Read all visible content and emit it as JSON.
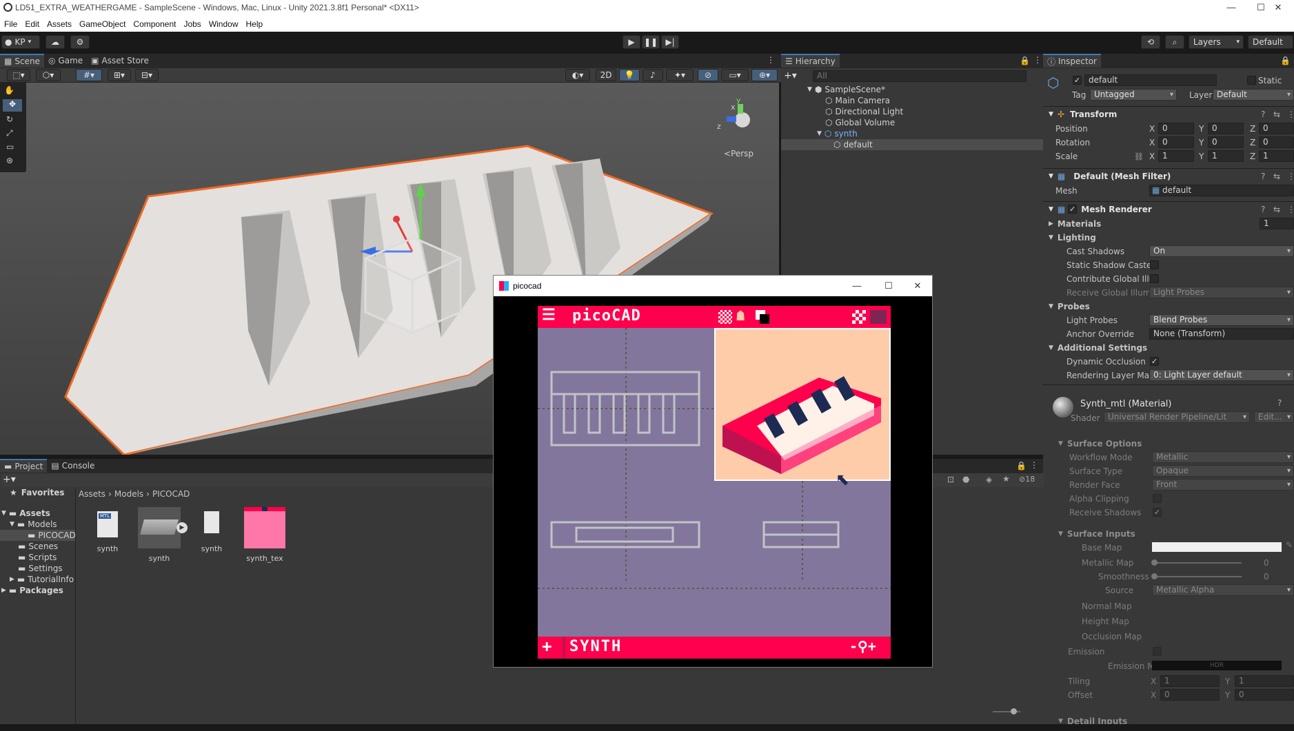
{
  "window": {
    "title": "LD51_EXTRA_WEATHERGAME - SampleScene - Windows, Mac, Linux - Unity 2021.3.8f1 Personal* <DX11>",
    "minimize": "—",
    "maximize": "☐",
    "close": "✕"
  },
  "menu": [
    "File",
    "Edit",
    "Assets",
    "GameObject",
    "Component",
    "Jobs",
    "Window",
    "Help"
  ],
  "toolbar": {
    "account": "KP",
    "layers": "Layers",
    "layout": "Default"
  },
  "scene_tabs": [
    "Scene",
    "Game",
    "Asset Store"
  ],
  "scene": {
    "mode_2d": "2D",
    "persp_label": "<Persp",
    "axis_x": "x",
    "axis_y": "y",
    "axis_z": "z"
  },
  "hierarchy": {
    "tab": "Hierarchy",
    "search_placeholder": "All",
    "items": [
      {
        "label": "SampleScene*"
      },
      {
        "label": "Main Camera"
      },
      {
        "label": "Directional Light"
      },
      {
        "label": "Global Volume"
      },
      {
        "label": "synth"
      },
      {
        "label": "default"
      }
    ]
  },
  "inspector": {
    "tab": "Inspector",
    "object_name": "default",
    "static_label": "Static",
    "tag_label": "Tag",
    "tag_value": "Untagged",
    "layer_label": "Layer",
    "layer_value": "Default",
    "transform": {
      "title": "Transform",
      "position_label": "Position",
      "rotation_label": "Rotation",
      "scale_label": "Scale",
      "position": [
        "0",
        "0",
        "0"
      ],
      "rotation": [
        "0",
        "0",
        "0"
      ],
      "scale": [
        "1",
        "1",
        "1"
      ],
      "x": "X",
      "y": "Y",
      "z": "Z"
    },
    "mesh_filter": {
      "title": "Default (Mesh Filter)",
      "mesh_label": "Mesh",
      "mesh_value": "default"
    },
    "mesh_renderer": {
      "title": "Mesh Renderer",
      "materials_label": "Materials",
      "materials_count": "1",
      "lighting_label": "Lighting",
      "cast_shadows_label": "Cast Shadows",
      "cast_shadows_value": "On",
      "static_shadow_label": "Static Shadow Caste",
      "contribute_gi_label": "Contribute Global Illu",
      "receive_gi_label": "Receive Global Illumi",
      "receive_gi_value": "Light Probes",
      "probes_label": "Probes",
      "light_probes_label": "Light Probes",
      "light_probes_value": "Blend Probes",
      "anchor_label": "Anchor Override",
      "anchor_value": "None (Transform)",
      "additional_label": "Additional Settings",
      "dynamic_occ_label": "Dynamic Occlusion",
      "rendering_layer_label": "Rendering Layer Mas",
      "rendering_layer_value": "0: Light Layer default"
    },
    "material": {
      "title": "Synth_mtl (Material)",
      "shader_label": "Shader",
      "shader_value": "Universal Render Pipeline/Lit",
      "edit_label": "Edit...",
      "surface_options": "Surface Options",
      "workflow_label": "Workflow Mode",
      "workflow_value": "Metallic",
      "surface_type_label": "Surface Type",
      "surface_type_value": "Opaque",
      "render_face_label": "Render Face",
      "render_face_value": "Front",
      "alpha_clip_label": "Alpha Clipping",
      "receive_shadows_label": "Receive Shadows",
      "surface_inputs": "Surface Inputs",
      "base_map_label": "Base Map",
      "metallic_map_label": "Metallic Map",
      "metallic_value": "0",
      "smoothness_label": "Smoothness",
      "smoothness_value": "0",
      "source_label": "Source",
      "source_value": "Metallic Alpha",
      "normal_map_label": "Normal Map",
      "height_map_label": "Height Map",
      "occlusion_map_label": "Occlusion Map",
      "emission_label": "Emission",
      "emission_map_label": "Emission M",
      "hdr_label": "HDR",
      "tiling_label": "Tiling",
      "tiling": [
        "1",
        "1"
      ],
      "offset_label": "Offset",
      "offset": [
        "0",
        "0"
      ],
      "detail_inputs": "Detail Inputs"
    }
  },
  "project": {
    "tabs": [
      "Project",
      "Console"
    ],
    "hidden_count": "18",
    "favorites": "Favorites",
    "tree": [
      {
        "label": "Assets"
      },
      {
        "label": "Models"
      },
      {
        "label": "PICOCAD"
      },
      {
        "label": "Scenes"
      },
      {
        "label": "Scripts"
      },
      {
        "label": "Settings"
      },
      {
        "label": "TutorialInfo"
      },
      {
        "label": "Packages"
      }
    ],
    "breadcrumb": [
      "Assets",
      "Models",
      "PICOCAD"
    ],
    "assets": [
      {
        "label": "synth",
        "badge": "MTL"
      },
      {
        "label": "synth"
      },
      {
        "label": "synth"
      },
      {
        "label": "synth_tex"
      }
    ]
  },
  "picocad": {
    "title": "picocad",
    "app_name": "picoCAD",
    "project_name": "SYNTH",
    "add": "+",
    "zoom": "-⚲+"
  },
  "colors": {
    "accent_blue": "#3a79bb",
    "pico_pink": "#ff004d",
    "pico_bg": "#83769c",
    "pico_preview": "#ffccaa",
    "selection_orange": "#f06a24"
  }
}
